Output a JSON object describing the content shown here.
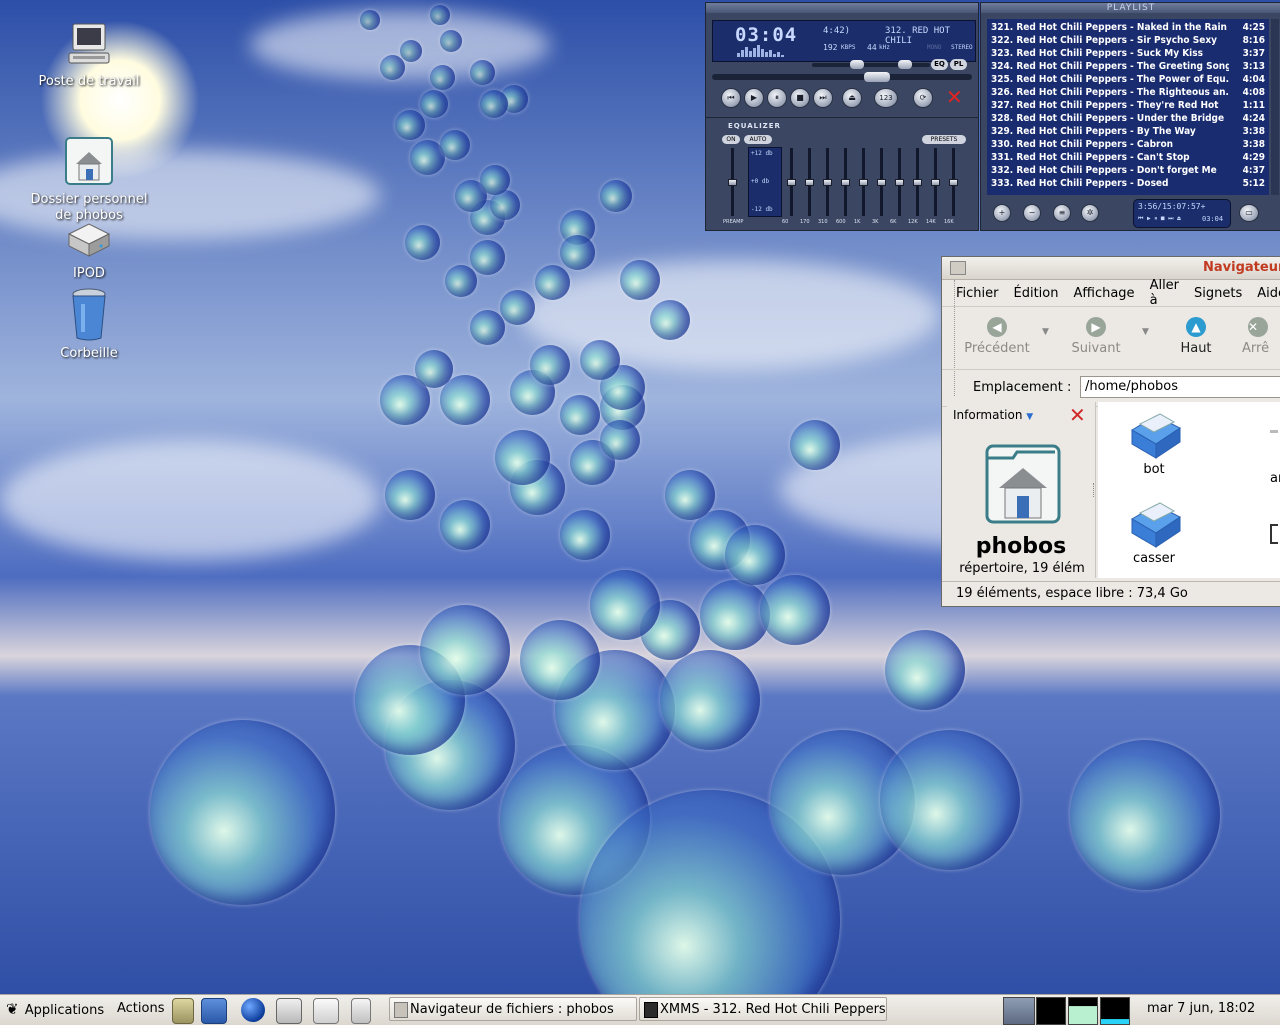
{
  "desktop": {
    "icons": [
      {
        "label": "Poste de travail",
        "icon": "computer-icon"
      },
      {
        "label": "Dossier personnel\nde phobos",
        "icon": "home-folder-icon"
      },
      {
        "label": "IPOD",
        "icon": "drive-icon"
      },
      {
        "label": "Corbeille",
        "icon": "trash-icon"
      }
    ]
  },
  "xmms": {
    "time": "03:04",
    "track_length": "4:42)",
    "track_title": "312. RED HOT CHILI",
    "kbps": "192",
    "kbps_unit": "KBPS",
    "khz": "44",
    "khz_unit": "kHz",
    "mono": "MONO",
    "stereo": "STEREO",
    "eq_btn": "EQ",
    "pl_btn": "PL",
    "equalizer": {
      "title": "EQUALIZER",
      "on": "ON",
      "auto": "AUTO",
      "presets": "PRESETS",
      "db_top": "+12 db",
      "db_mid": "+0 db",
      "db_bot": "-12 db",
      "bands": [
        "PREAMP",
        "60",
        "170",
        "310",
        "600",
        "1K",
        "3K",
        "6K",
        "12K",
        "14K",
        "16K"
      ],
      "levels": [
        0.5,
        0.5,
        0.5,
        0.5,
        0.5,
        0.5,
        0.5,
        0.5,
        0.5,
        0.5,
        0.5
      ]
    },
    "playlist": {
      "title": "PLAYLIST",
      "rows": [
        {
          "title": "321. Red Hot Chili Peppers - Naked in the Rain",
          "dur": "4:25"
        },
        {
          "title": "322. Red Hot Chili Peppers - Sir Psycho Sexy",
          "dur": "8:16"
        },
        {
          "title": "323. Red Hot Chili Peppers - Suck My Kiss",
          "dur": "3:37"
        },
        {
          "title": "324. Red Hot Chili Peppers - The Greeting Song",
          "dur": "3:13"
        },
        {
          "title": "325. Red Hot Chili Peppers - The Power of Equ...",
          "dur": "4:04"
        },
        {
          "title": "326. Red Hot Chili Peppers - The Righteous an...",
          "dur": "4:08"
        },
        {
          "title": "327. Red Hot Chili Peppers - They're Red Hot",
          "dur": "1:11"
        },
        {
          "title": "328. Red Hot Chili Peppers - Under the Bridge",
          "dur": "4:24"
        },
        {
          "title": "329. Red Hot Chili Peppers - By The Way",
          "dur": "3:38"
        },
        {
          "title": "330. Red Hot Chili Peppers - Cabron",
          "dur": "3:38"
        },
        {
          "title": "331. Red Hot Chili Peppers - Can't Stop",
          "dur": "4:29"
        },
        {
          "title": "332. Red Hot Chili Peppers - Don't forget Me",
          "dur": "4:37"
        },
        {
          "title": "333. Red Hot Chili Peppers - Dosed",
          "dur": "5:12"
        }
      ],
      "total_time": "3:56/15:07:57+",
      "mini_time": "03:04"
    }
  },
  "nautilus": {
    "title": "Navigateur",
    "menu": [
      "Fichier",
      "Édition",
      "Affichage",
      "Aller à",
      "Signets",
      "Aide"
    ],
    "toolbar": {
      "back": "Précédent",
      "forward": "Suivant",
      "up": "Haut",
      "stop": "Arrê"
    },
    "location_label": "Emplacement :",
    "location_value": "/home/phobos",
    "side_pane": {
      "selector": "Information",
      "folder_name": "phobos",
      "folder_info": "répertoire, 19 élém"
    },
    "files": [
      {
        "name": "bot"
      },
      {
        "name": "casser"
      },
      {
        "name": "ar"
      }
    ],
    "status": "19 éléments, espace libre : 73,4 Go"
  },
  "taskbar": {
    "applications": "Applications",
    "actions": "Actions",
    "tasks": [
      {
        "label": "Navigateur de fichiers : phobos"
      },
      {
        "label": "XMMS - 312. Red Hot Chili Peppers"
      }
    ],
    "clock": "mar  7 jun, 18:02"
  },
  "colors": {
    "xmms_lcd": "#1b2d6b",
    "playlist_bg": "#1a2c70",
    "nautilus_title": "#c23a20",
    "taskbar": "#e6e3dd"
  }
}
